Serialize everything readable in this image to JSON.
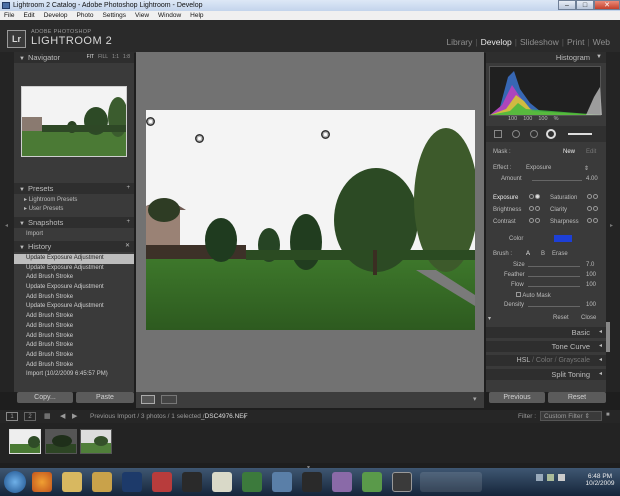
{
  "window": {
    "title": "Lightroom 2 Catalog - Adobe Photoshop Lightroom - Develop",
    "controls": [
      "–",
      "□",
      "✕"
    ]
  },
  "menu": [
    "File",
    "Edit",
    "Develop",
    "Photo",
    "Settings",
    "View",
    "Window",
    "Help"
  ],
  "header": {
    "logo": "Lr",
    "brand_small": "ADOBE PHOTOSHOP",
    "brand": "LIGHTROOM 2",
    "modules": [
      "Library",
      "Develop",
      "Slideshow",
      "Print",
      "Web"
    ],
    "active_module": "Develop"
  },
  "left": {
    "navigator": {
      "title": "Navigator",
      "zoom_options": [
        "FIT",
        "FILL",
        "1:1",
        "1:8"
      ]
    },
    "presets": {
      "title": "Presets",
      "items": [
        "Lightroom Presets",
        "User Presets"
      ]
    },
    "snapshots": {
      "title": "Snapshots",
      "items": [
        "Import"
      ]
    },
    "history": {
      "title": "History",
      "items": [
        "Update Exposure Adjustment",
        "Update Exposure Adjustment",
        "Add Brush Stroke",
        "Update Exposure Adjustment",
        "Add Brush Stroke",
        "Update Exposure Adjustment",
        "Add Brush Stroke",
        "Add Brush Stroke",
        "Add Brush Stroke",
        "Add Brush Stroke",
        "Add Brush Stroke",
        "Add Brush Stroke",
        "Import (10/2/2009 6:45:57 PM)"
      ],
      "selected_index": 0
    },
    "buttons": {
      "copy": "Copy...",
      "paste": "Paste"
    }
  },
  "right": {
    "histogram": {
      "title": "Histogram",
      "readout": [
        "100",
        "100",
        "100",
        "%"
      ]
    },
    "mask": {
      "label": "Mask :",
      "new": "New",
      "edit": "Edit"
    },
    "effect": {
      "label": "Effect :",
      "preset": "Exposure",
      "amount_label": "Amount",
      "amount_value": "4.00"
    },
    "adjust": {
      "exposure": "Exposure",
      "brightness": "Brightness",
      "contrast": "Contrast",
      "saturation": "Saturation",
      "clarity": "Clarity",
      "sharpness": "Sharpness",
      "color": "Color"
    },
    "brush": {
      "label": "Brush :",
      "a": "A",
      "b": "B",
      "erase": "Erase",
      "size_label": "Size",
      "size_value": "7.0",
      "feather_label": "Feather",
      "feather_value": "100",
      "flow_label": "Flow",
      "flow_value": "100",
      "automask": "Auto Mask",
      "density_label": "Density",
      "density_value": "100"
    },
    "reset": "Reset",
    "close": "Close",
    "sections": {
      "basic": "Basic",
      "tone_curve": "Tone Curve",
      "hsl": "HSL",
      "color": "Color",
      "grayscale": "Grayscale",
      "split_toning": "Split Toning"
    },
    "buttons": {
      "previous": "Previous",
      "reset": "Reset"
    }
  },
  "filmstrip": {
    "pages": [
      "1",
      "2"
    ],
    "path": "Previous Import / 3 photos / 1 selected /",
    "filename": "_DSC4976.NEF",
    "filter_label": "Filter :",
    "filter_value": "Custom Filter"
  },
  "taskbar": {
    "time": "6:48 PM",
    "date": "10/2/2009"
  }
}
